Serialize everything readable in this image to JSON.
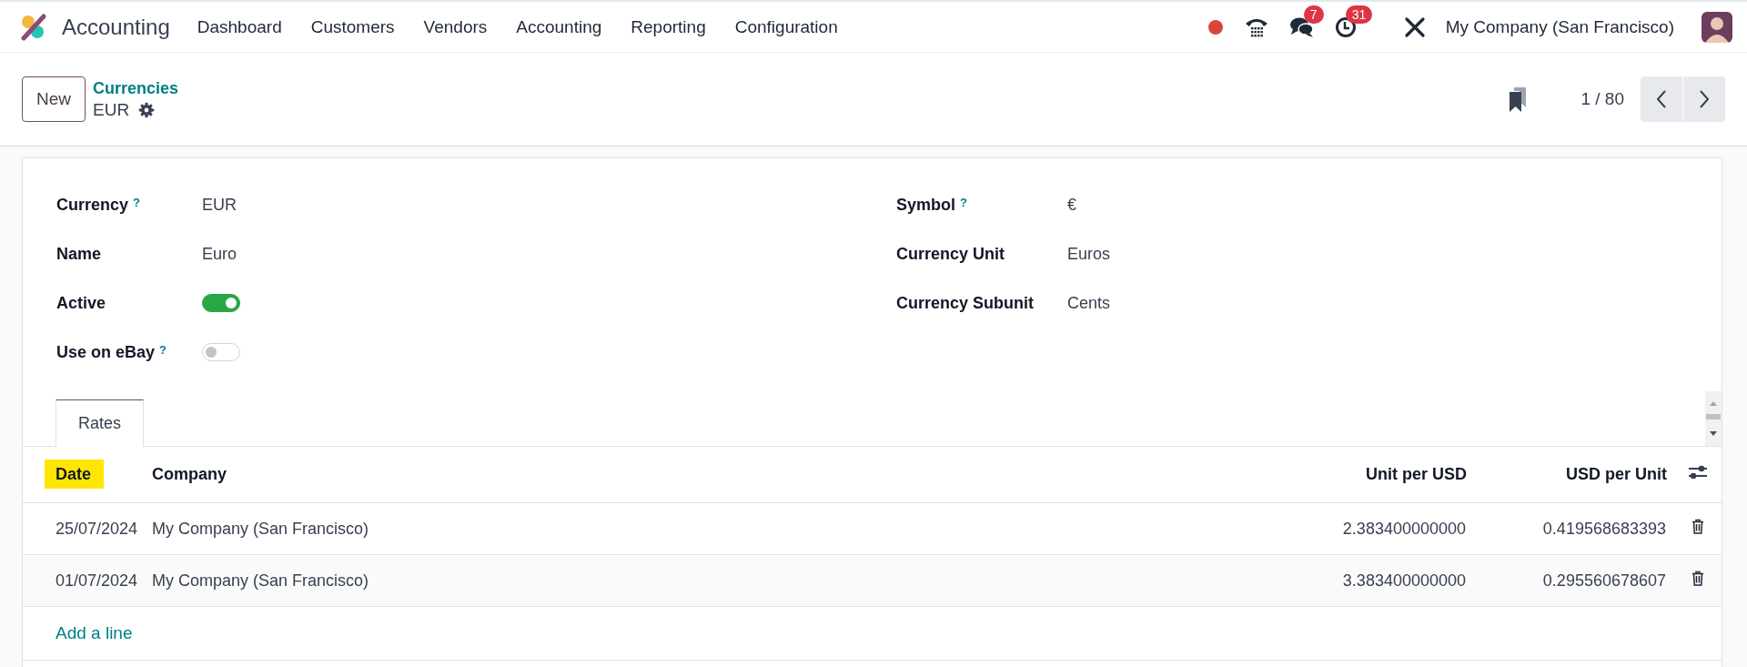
{
  "app": {
    "name": "Accounting"
  },
  "menu": [
    {
      "label": "Dashboard"
    },
    {
      "label": "Customers"
    },
    {
      "label": "Vendors"
    },
    {
      "label": "Accounting"
    },
    {
      "label": "Reporting"
    },
    {
      "label": "Configuration"
    }
  ],
  "systray": {
    "messages_count": "7",
    "activities_count": "31",
    "company": "My Company (San Francisco)"
  },
  "control_panel": {
    "new_button": "New",
    "breadcrumb": "Currencies",
    "record": "EUR",
    "pager": "1 / 80"
  },
  "fields_left": [
    {
      "label": "Currency",
      "help": "?",
      "kind": "text",
      "value": "EUR"
    },
    {
      "label": "Name",
      "kind": "text",
      "value": "Euro"
    },
    {
      "label": "Active",
      "kind": "toggle",
      "on": true
    },
    {
      "label": "Use on eBay",
      "help": "?",
      "kind": "toggle",
      "on": false
    }
  ],
  "fields_right": [
    {
      "label": "Symbol",
      "help": "?",
      "kind": "text",
      "value": "€"
    },
    {
      "label": "Currency Unit",
      "kind": "text",
      "value": "Euros"
    },
    {
      "label": "Currency Subunit",
      "kind": "text",
      "value": "Cents"
    }
  ],
  "tabs": [
    {
      "label": "Rates",
      "selected": true
    }
  ],
  "table": {
    "columns": [
      {
        "label": "Date",
        "kind": "date",
        "highlighted": true
      },
      {
        "label": "Company",
        "kind": "text",
        "highlighted": false
      },
      {
        "label": "Unit per USD",
        "kind": "number",
        "highlighted": false
      },
      {
        "label": "USD per Unit",
        "kind": "number",
        "highlighted": false
      }
    ],
    "rows": [
      {
        "cells": [
          "25/07/2024",
          "My Company (San Francisco)",
          "2.383400000000",
          "0.419568683393"
        ]
      },
      {
        "cells": [
          "01/07/2024",
          "My Company (San Francisco)",
          "3.383400000000",
          "0.295560678607"
        ]
      }
    ],
    "add_line": "Add a line"
  }
}
